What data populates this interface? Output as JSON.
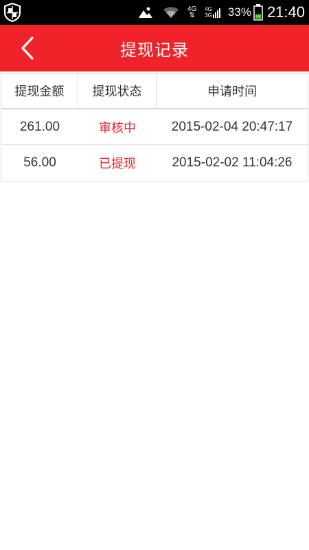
{
  "status_bar": {
    "network_top": "4G",
    "network_small_top": "4G",
    "network_small_bottom": "3G",
    "battery_percent": "33%",
    "time": "21:40",
    "icons": [
      "shield-icon",
      "image-icon",
      "wifi-icon",
      "data-arrows-icon",
      "signal-icon",
      "battery-icon"
    ]
  },
  "header": {
    "title": "提现记录",
    "background_color": "#f0222a",
    "back_icon": "chevron-left-icon"
  },
  "table": {
    "columns": [
      "提现金额",
      "提现状态",
      "申请时间"
    ],
    "rows": [
      {
        "amount": "261.00",
        "status": "审核中",
        "time": "2015-02-04 20:47:17"
      },
      {
        "amount": "56.00",
        "status": "已提现",
        "time": "2015-02-02 11:04:26"
      }
    ],
    "status_color": "#e4262b"
  }
}
